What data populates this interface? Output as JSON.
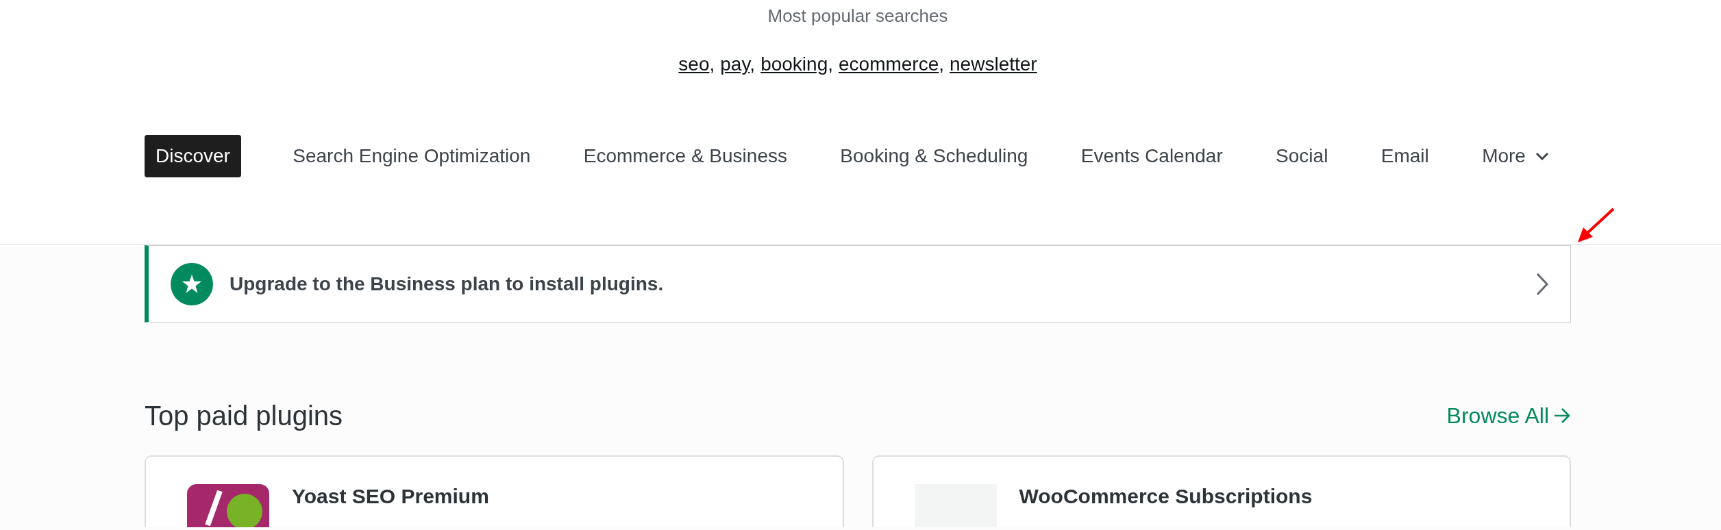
{
  "searches": {
    "title": "Most popular searches",
    "separator": ",",
    "terms": [
      "seo",
      "pay",
      "booking",
      "ecommerce",
      "newsletter"
    ]
  },
  "categories": [
    {
      "label": "Discover",
      "selected": true,
      "kind": "link"
    },
    {
      "label": "Search Engine Optimization",
      "selected": false,
      "kind": "link"
    },
    {
      "label": "Ecommerce & Business",
      "selected": false,
      "kind": "link"
    },
    {
      "label": "Booking & Scheduling",
      "selected": false,
      "kind": "link"
    },
    {
      "label": "Events Calendar",
      "selected": false,
      "kind": "link"
    },
    {
      "label": "Social",
      "selected": false,
      "kind": "link"
    },
    {
      "label": "Email",
      "selected": false,
      "kind": "link"
    },
    {
      "label": "More",
      "selected": false,
      "kind": "dropdown"
    }
  ],
  "upgrade_banner": {
    "message": "Upgrade to the Business plan to install plugins."
  },
  "section": {
    "title": "Top paid plugins",
    "link": "Browse All"
  },
  "plugins": [
    {
      "name": "Yoast SEO Premium",
      "kind": "badge"
    },
    {
      "name": "WooCommerce Subscriptions",
      "kind": "plain"
    }
  ]
}
